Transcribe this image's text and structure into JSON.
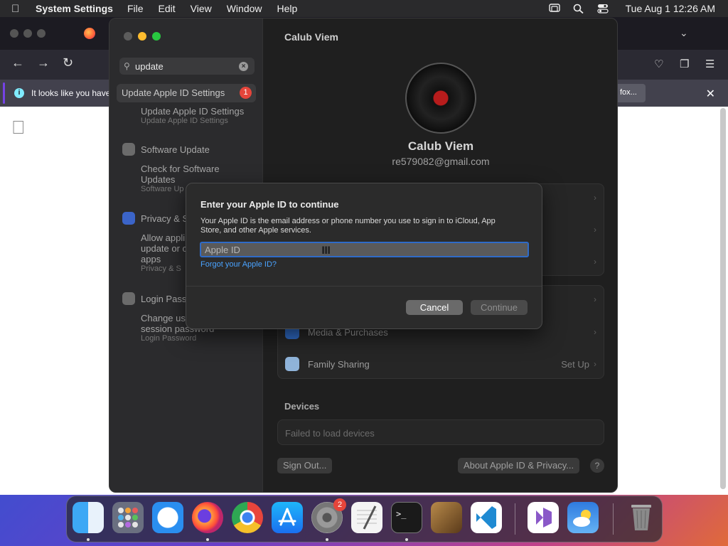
{
  "menubar": {
    "app_name": "System Settings",
    "menus": [
      "File",
      "Edit",
      "View",
      "Window",
      "Help"
    ],
    "clock": "Tue Aug 1  12:26 AM"
  },
  "browser": {
    "notice_text": "It looks like you have",
    "notice_button": "fox..."
  },
  "sidebar": {
    "search_value": "update",
    "selected_item": "Update Apple ID Settings",
    "selected_badge": "1",
    "results": [
      {
        "main": "Update Apple ID Settings",
        "sub": "Update Apple ID Settings"
      },
      {
        "header": "Software Update",
        "main1": "Check for Software",
        "main2": "Updates",
        "sub": "Software Up"
      },
      {
        "header": "Privacy & S",
        "main1": "Allow appli",
        "main2": "update or c",
        "main3": "apps",
        "sub": "Privacy & S"
      },
      {
        "header": "Login Pass",
        "main1": "Change us",
        "main2": "session password",
        "sub": "Login Password"
      }
    ]
  },
  "pane": {
    "title": "Calub Viem",
    "user_name": "Calub Viem",
    "user_email": "re579082@gmail.com",
    "rows": [
      {
        "label": "Media & Purchases",
        "value": ""
      },
      {
        "label": "Family Sharing",
        "value": "Set Up"
      }
    ],
    "devices_label": "Devices",
    "devices_status": "Failed to load devices",
    "sign_out": "Sign Out...",
    "about": "About Apple ID & Privacy...",
    "help": "?"
  },
  "dialog": {
    "title": "Enter your Apple ID to continue",
    "description": "Your Apple ID is the email address or phone number you use to sign in to iCloud, App Store, and other Apple services.",
    "input_value": "",
    "input_placeholder": "Apple ID",
    "forgot_link": "Forgot your Apple ID?",
    "cancel": "Cancel",
    "continue": "Continue"
  },
  "dock": {
    "settings_badge": "2"
  },
  "colors": {
    "accent": "#2f6bc7",
    "link": "#4aa3ff",
    "badge": "#e5453b"
  }
}
